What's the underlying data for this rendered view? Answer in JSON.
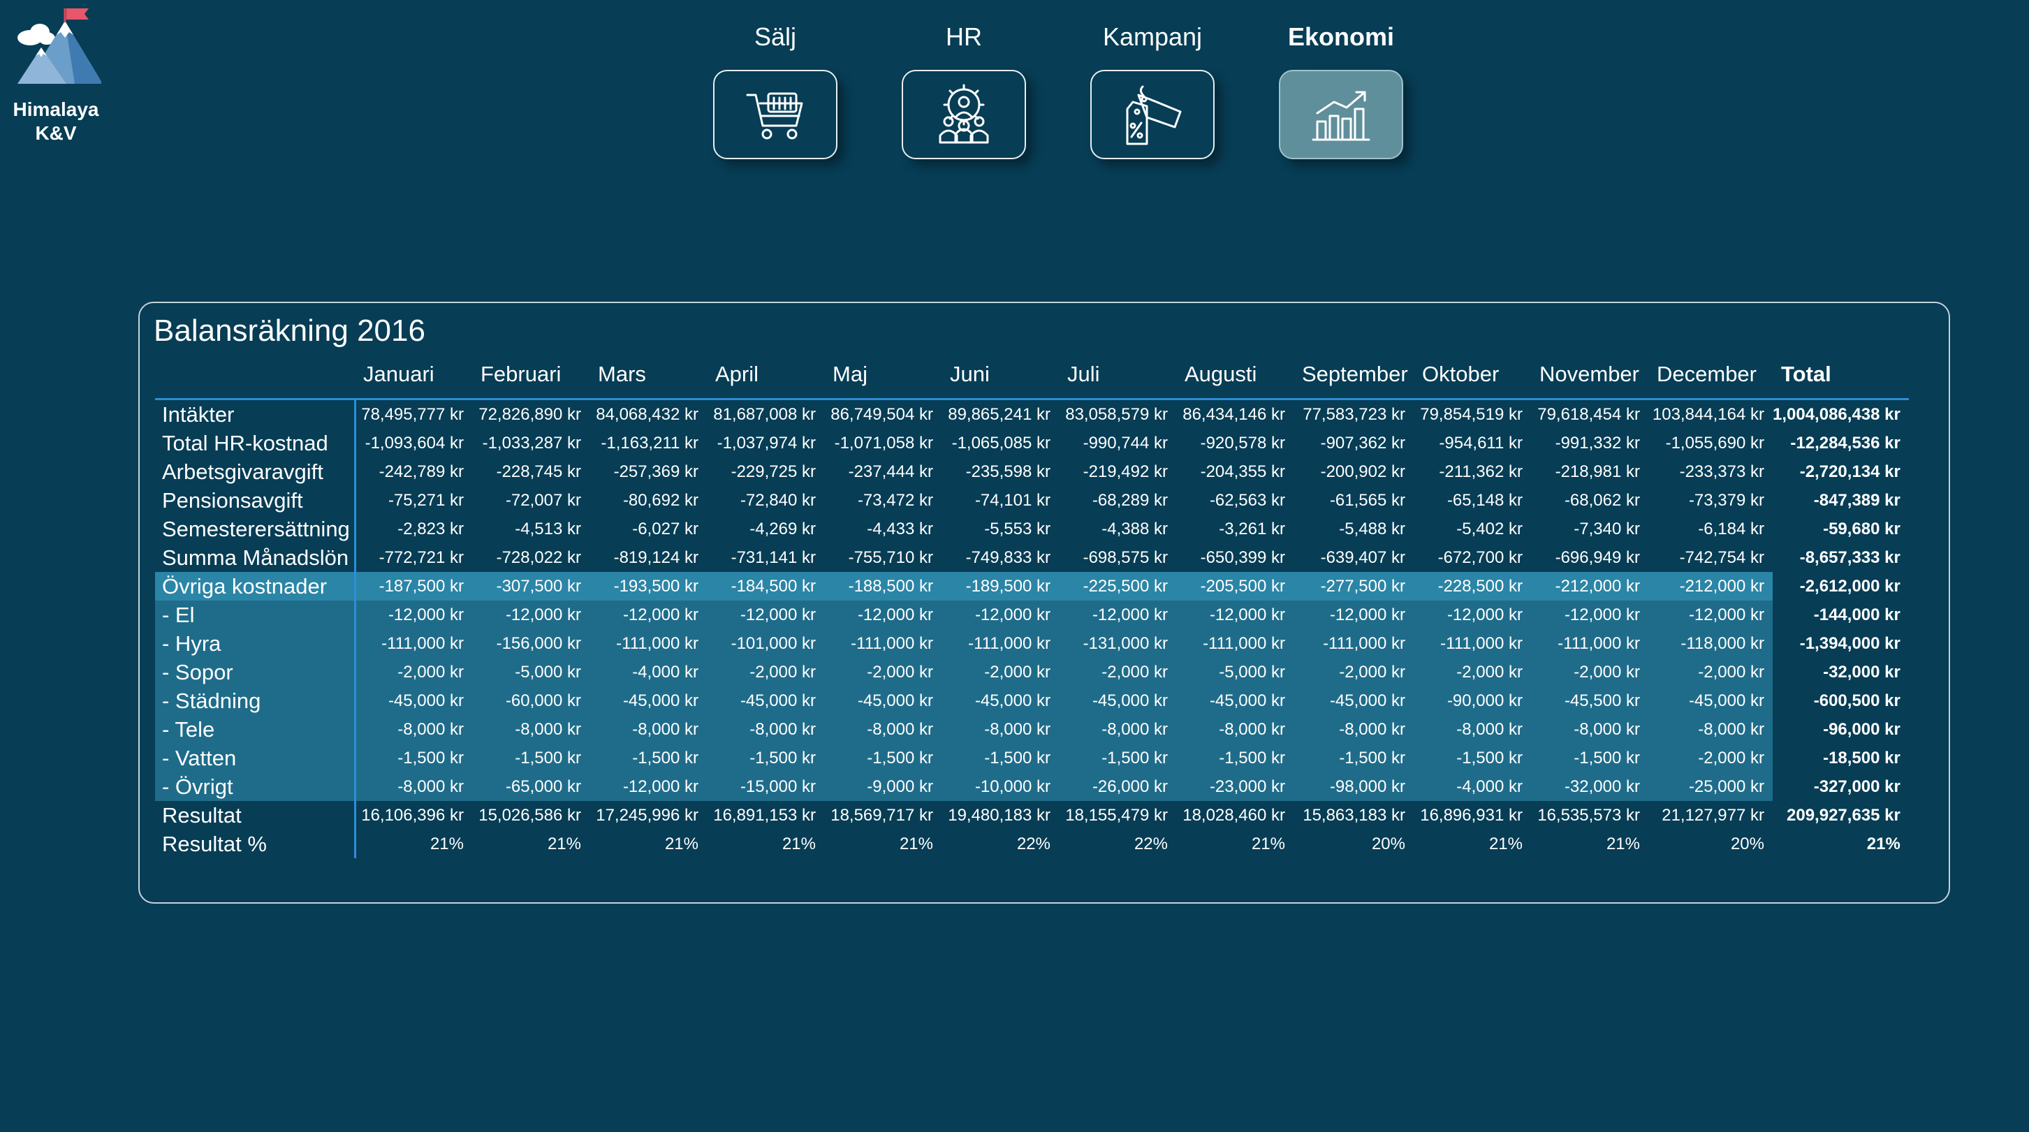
{
  "app": {
    "name_line1": "Himalaya",
    "name_line2": "K&V"
  },
  "nav": [
    {
      "label": "Sälj",
      "icon": "shopping-cart-icon",
      "active": false
    },
    {
      "label": "HR",
      "icon": "people-gear-icon",
      "active": false
    },
    {
      "label": "Kampanj",
      "icon": "price-tag-percent-icon",
      "active": false
    },
    {
      "label": "Ekonomi",
      "icon": "bar-chart-trend-icon",
      "active": true
    }
  ],
  "table": {
    "title": "Balansräkning 2016",
    "columns": [
      "Januari",
      "Februari",
      "Mars",
      "April",
      "Maj",
      "Juni",
      "Juli",
      "Augusti",
      "September",
      "Oktober",
      "November",
      "December"
    ],
    "total_label": "Total",
    "rows": [
      {
        "label": "Intäkter",
        "values": [
          "78,495,777 kr",
          "72,826,890 kr",
          "84,068,432 kr",
          "81,687,008 kr",
          "86,749,504 kr",
          "89,865,241 kr",
          "83,058,579 kr",
          "86,434,146 kr",
          "77,583,723 kr",
          "79,854,519 kr",
          "79,618,454 kr",
          "103,844,164 kr"
        ],
        "total": "1,004,086,438 kr"
      },
      {
        "label": "Total HR-kostnad",
        "values": [
          "-1,093,604 kr",
          "-1,033,287 kr",
          "-1,163,211 kr",
          "-1,037,974 kr",
          "-1,071,058 kr",
          "-1,065,085 kr",
          "-990,744 kr",
          "-920,578 kr",
          "-907,362 kr",
          "-954,611 kr",
          "-991,332 kr",
          "-1,055,690 kr"
        ],
        "total": "-12,284,536 kr"
      },
      {
        "label": "Arbetsgivaravgift",
        "values": [
          "-242,789 kr",
          "-228,745 kr",
          "-257,369 kr",
          "-229,725 kr",
          "-237,444 kr",
          "-235,598 kr",
          "-219,492 kr",
          "-204,355 kr",
          "-200,902 kr",
          "-211,362 kr",
          "-218,981 kr",
          "-233,373 kr"
        ],
        "total": "-2,720,134 kr"
      },
      {
        "label": "Pensionsavgift",
        "values": [
          "-75,271 kr",
          "-72,007 kr",
          "-80,692 kr",
          "-72,840 kr",
          "-73,472 kr",
          "-74,101 kr",
          "-68,289 kr",
          "-62,563 kr",
          "-61,565 kr",
          "-65,148 kr",
          "-68,062 kr",
          "-73,379 kr"
        ],
        "total": "-847,389 kr"
      },
      {
        "label": "Semesterersättning",
        "values": [
          "-2,823 kr",
          "-4,513 kr",
          "-6,027 kr",
          "-4,269 kr",
          "-4,433 kr",
          "-5,553 kr",
          "-4,388 kr",
          "-3,261 kr",
          "-5,488 kr",
          "-5,402 kr",
          "-7,340 kr",
          "-6,184 kr"
        ],
        "total": "-59,680 kr"
      },
      {
        "label": "Summa Månadslön",
        "values": [
          "-772,721 kr",
          "-728,022 kr",
          "-819,124 kr",
          "-731,141 kr",
          "-755,710 kr",
          "-749,833 kr",
          "-698,575 kr",
          "-650,399 kr",
          "-639,407 kr",
          "-672,700 kr",
          "-696,949 kr",
          "-742,754 kr"
        ],
        "total": "-8,657,333 kr"
      },
      {
        "label": "Övriga kostnader",
        "highlight": "strong",
        "values": [
          "-187,500 kr",
          "-307,500 kr",
          "-193,500 kr",
          "-184,500 kr",
          "-188,500 kr",
          "-189,500 kr",
          "-225,500 kr",
          "-205,500 kr",
          "-277,500 kr",
          "-228,500 kr",
          "-212,000 kr",
          "-212,000 kr"
        ],
        "total": "-2,612,000 kr"
      },
      {
        "label": "- El",
        "highlight": "soft",
        "values": [
          "-12,000 kr",
          "-12,000 kr",
          "-12,000 kr",
          "-12,000 kr",
          "-12,000 kr",
          "-12,000 kr",
          "-12,000 kr",
          "-12,000 kr",
          "-12,000 kr",
          "-12,000 kr",
          "-12,000 kr",
          "-12,000 kr"
        ],
        "total": "-144,000 kr"
      },
      {
        "label": "- Hyra",
        "highlight": "soft",
        "values": [
          "-111,000 kr",
          "-156,000 kr",
          "-111,000 kr",
          "-101,000 kr",
          "-111,000 kr",
          "-111,000 kr",
          "-131,000 kr",
          "-111,000 kr",
          "-111,000 kr",
          "-111,000 kr",
          "-111,000 kr",
          "-118,000 kr"
        ],
        "total": "-1,394,000 kr"
      },
      {
        "label": "- Sopor",
        "highlight": "soft",
        "values": [
          "-2,000 kr",
          "-5,000 kr",
          "-4,000 kr",
          "-2,000 kr",
          "-2,000 kr",
          "-2,000 kr",
          "-2,000 kr",
          "-5,000 kr",
          "-2,000 kr",
          "-2,000 kr",
          "-2,000 kr",
          "-2,000 kr"
        ],
        "total": "-32,000 kr"
      },
      {
        "label": "- Städning",
        "highlight": "soft",
        "values": [
          "-45,000 kr",
          "-60,000 kr",
          "-45,000 kr",
          "-45,000 kr",
          "-45,000 kr",
          "-45,000 kr",
          "-45,000 kr",
          "-45,000 kr",
          "-45,000 kr",
          "-90,000 kr",
          "-45,500 kr",
          "-45,000 kr"
        ],
        "total": "-600,500 kr"
      },
      {
        "label": "- Tele",
        "highlight": "soft",
        "values": [
          "-8,000 kr",
          "-8,000 kr",
          "-8,000 kr",
          "-8,000 kr",
          "-8,000 kr",
          "-8,000 kr",
          "-8,000 kr",
          "-8,000 kr",
          "-8,000 kr",
          "-8,000 kr",
          "-8,000 kr",
          "-8,000 kr"
        ],
        "total": "-96,000 kr"
      },
      {
        "label": "- Vatten",
        "highlight": "soft",
        "values": [
          "-1,500 kr",
          "-1,500 kr",
          "-1,500 kr",
          "-1,500 kr",
          "-1,500 kr",
          "-1,500 kr",
          "-1,500 kr",
          "-1,500 kr",
          "-1,500 kr",
          "-1,500 kr",
          "-1,500 kr",
          "-2,000 kr"
        ],
        "total": "-18,500 kr"
      },
      {
        "label": "- Övrigt",
        "highlight": "soft",
        "values": [
          "-8,000 kr",
          "-65,000 kr",
          "-12,000 kr",
          "-15,000 kr",
          "-9,000 kr",
          "-10,000 kr",
          "-26,000 kr",
          "-23,000 kr",
          "-98,000 kr",
          "-4,000 kr",
          "-32,000 kr",
          "-25,000 kr"
        ],
        "total": "-327,000 kr"
      },
      {
        "label": "Resultat",
        "values": [
          "16,106,396 kr",
          "15,026,586 kr",
          "17,245,996 kr",
          "16,891,153 kr",
          "18,569,717 kr",
          "19,480,183 kr",
          "18,155,479 kr",
          "18,028,460 kr",
          "15,863,183 kr",
          "16,896,931 kr",
          "16,535,573 kr",
          "21,127,977 kr"
        ],
        "total": "209,927,635 kr"
      },
      {
        "label": "Resultat %",
        "values": [
          "21%",
          "21%",
          "21%",
          "21%",
          "21%",
          "22%",
          "22%",
          "21%",
          "20%",
          "21%",
          "21%",
          "20%"
        ],
        "total": "21%"
      }
    ]
  },
  "colors": {
    "background": "#073d55",
    "highlight_strong": "#2b85a6",
    "highlight_soft": "#1f6c8a",
    "accent_line": "#2a8fd6",
    "active_button": "#5f8f9b"
  }
}
